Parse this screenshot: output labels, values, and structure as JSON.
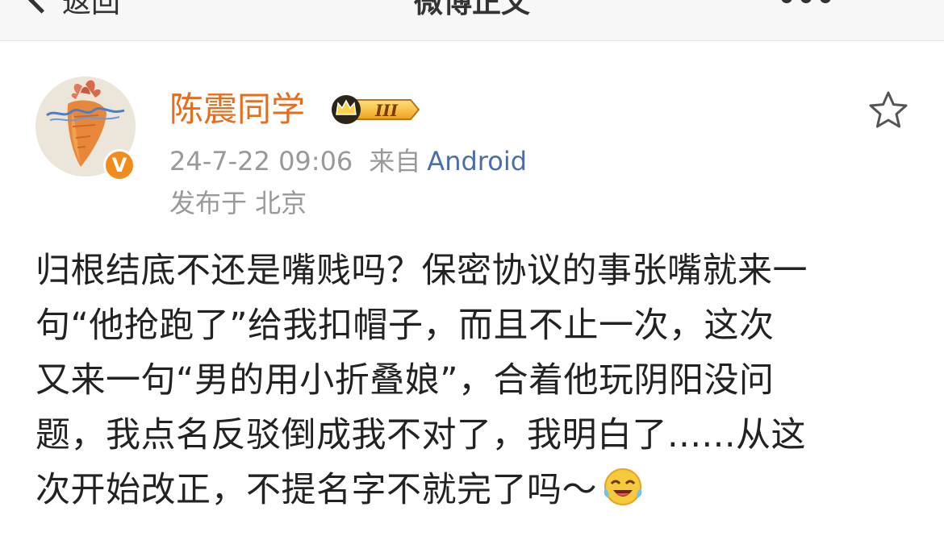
{
  "nav": {
    "back_label": "返回",
    "title": "微博正文"
  },
  "user": {
    "name": "陈震同学",
    "verified_mark": "V",
    "vip_level": "III"
  },
  "post_meta": {
    "time": "24-7-22 09:06",
    "source_prefix": "来自",
    "source": "Android",
    "location": "发布于 北京"
  },
  "post": {
    "lines": [
      "归根结底不还是嘴贱吗？保密协议的事张嘴就来一",
      "句“他抢跑了”给我扣帽子，而且不止一次，这次",
      "又来一句“男的用小折叠娘”，合着他玩阴阳没问",
      "题，我点名反驳倒成我不对了，我明白了......从这",
      "次开始改正，不提名字不就完了吗～"
    ],
    "emoji": "laughing-crying-emoji"
  },
  "icons": {
    "favorite": "star-outline-icon",
    "more": "more-dots-icon",
    "back": "chevron-left-icon"
  },
  "colors": {
    "username": "#e86c19",
    "source_link": "#4a6ea8",
    "meta_text": "#999999",
    "body_text": "#222222",
    "verified_badge": "#f38a1c"
  }
}
